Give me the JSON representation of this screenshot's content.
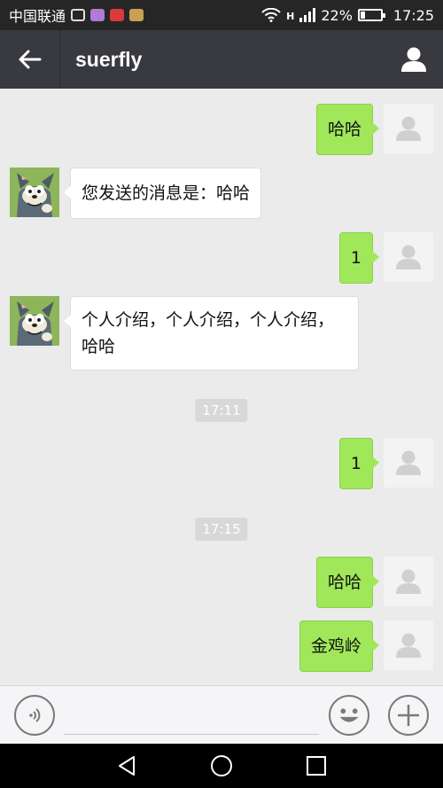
{
  "status_bar": {
    "carrier": "中国联通",
    "signal_type": "H",
    "battery": "22%",
    "battery_level": 0.22,
    "time": "17:25"
  },
  "header": {
    "back_icon": "arrow-left-icon",
    "title": "suerfly",
    "profile_icon": "person-icon"
  },
  "messages": [
    {
      "side": "right",
      "text": "哈哈"
    },
    {
      "side": "left",
      "text": "您发送的消息是：哈哈"
    },
    {
      "side": "right",
      "text": "1"
    },
    {
      "side": "left",
      "text": "个人介绍，个人介绍，个人介绍，哈哈"
    },
    {
      "side": "time",
      "text": "17:11"
    },
    {
      "side": "right",
      "text": "1"
    },
    {
      "side": "time",
      "text": "17:15"
    },
    {
      "side": "right",
      "text": "哈哈"
    },
    {
      "side": "right",
      "text": "金鸡岭"
    }
  ],
  "input_bar": {
    "voice_icon": "voice-icon",
    "emoji_icon": "emoji-icon",
    "plus_icon": "plus-icon"
  },
  "colors": {
    "sent_bubble": "#a0e75a",
    "header_bg": "#393a3f",
    "chat_bg": "#ebebeb"
  }
}
